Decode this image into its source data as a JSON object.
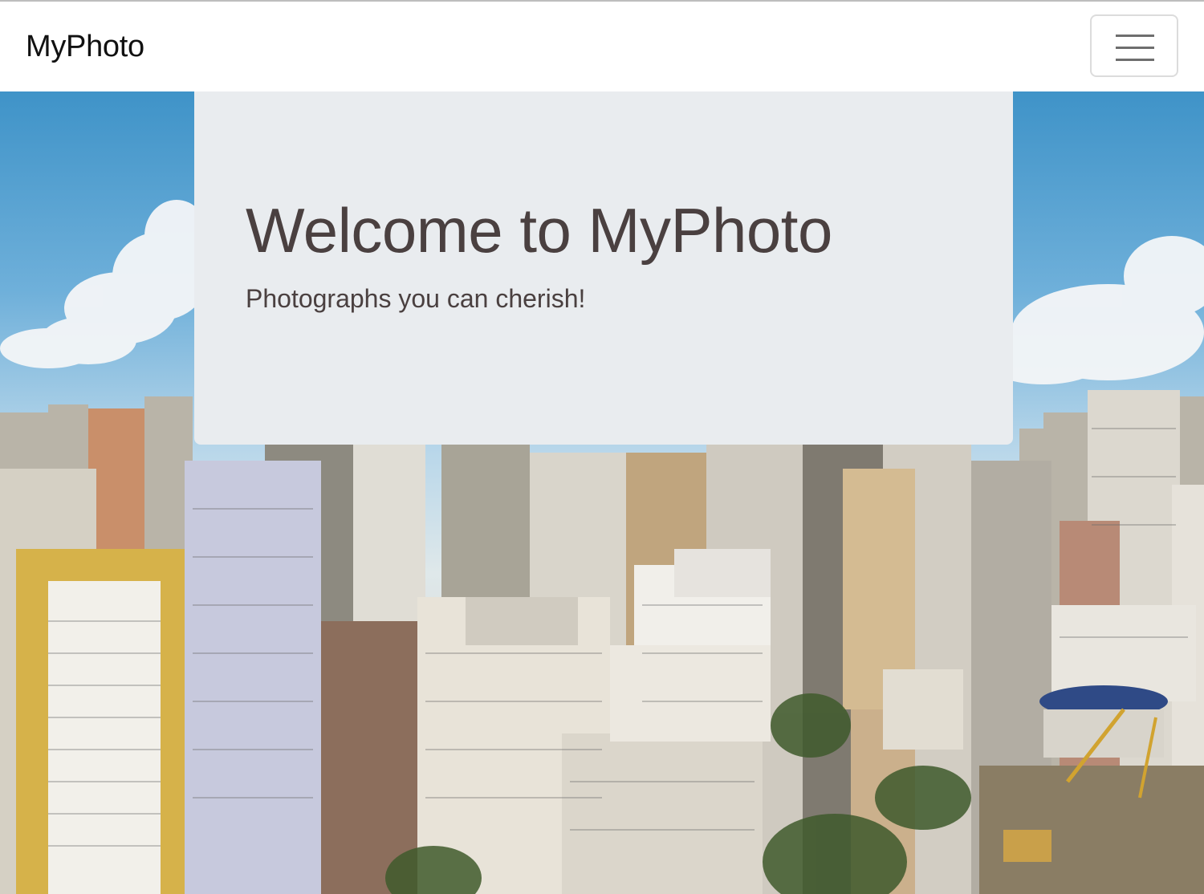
{
  "navbar": {
    "brand": "MyPhoto",
    "toggler_icon": "hamburger-menu-icon"
  },
  "jumbotron": {
    "heading": "Welcome to MyPhoto",
    "lead": "Photographs you can cherish!"
  },
  "colors": {
    "jumbotron_bg": "#e9ecef",
    "heading_text": "#4a4040",
    "navbar_bg": "#ffffff"
  }
}
